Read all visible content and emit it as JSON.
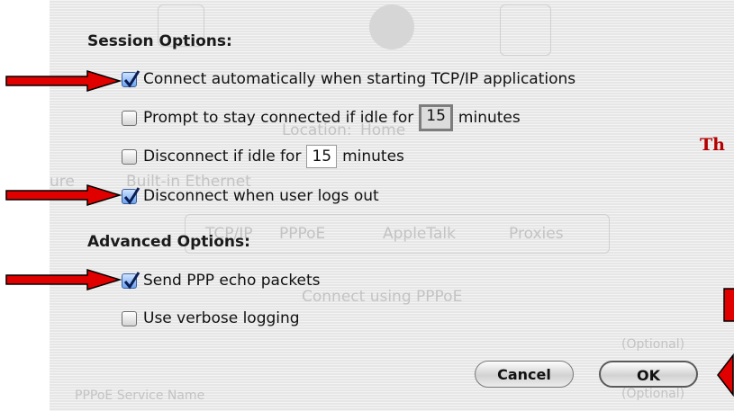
{
  "background": {
    "ghost_location_label": "Location:",
    "ghost_location_value": "Home",
    "ghost_configure_prefix": "ure",
    "ghost_configure_value": "Built-in Ethernet",
    "ghost_tabs": [
      "TCP/IP",
      "PPPoE",
      "AppleTalk",
      "Proxies"
    ],
    "ghost_pppoe_checkbox": "Connect using PPPoE",
    "ghost_optional_1": "(Optional)",
    "ghost_optional_2": "(Optional)",
    "ghost_service_name": "PPPoE Service Name"
  },
  "session_options": {
    "heading": "Session Options:",
    "connect_auto": {
      "label": "Connect automatically when starting TCP/IP applications",
      "checked": true
    },
    "prompt_idle": {
      "label_before": "Prompt to stay connected if idle for",
      "value": "15",
      "label_after": "minutes",
      "checked": false
    },
    "disconnect_idle": {
      "label_before": "Disconnect if idle for",
      "value": "15",
      "label_after": "minutes",
      "checked": false
    },
    "disconnect_logout": {
      "label": "Disconnect when user logs out",
      "checked": true
    }
  },
  "advanced_options": {
    "heading": "Advanced Options:",
    "send_echo": {
      "label": "Send PPP echo packets",
      "checked": true
    },
    "verbose_logging": {
      "label": "Use verbose logging",
      "checked": false
    }
  },
  "buttons": {
    "cancel": "Cancel",
    "ok": "OK"
  },
  "annotation": {
    "side_text": "Th",
    "arrow_color": "#e00000"
  }
}
